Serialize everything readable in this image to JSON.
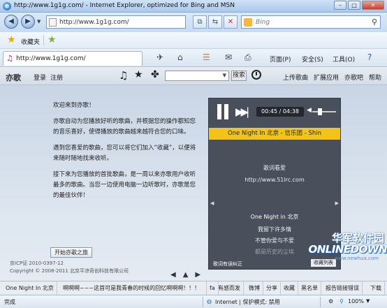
{
  "window": {
    "title": "http://www.1g1g.com/ - Internet Explorer, optimized for Bing and MSN"
  },
  "navbar": {
    "address": "http://www.1g1g.com/",
    "search_placeholder": "Bing"
  },
  "favbar": {
    "favorites_label": "收藏夹"
  },
  "cmdbar": {
    "tab_title": "http://www.1g1g.com/",
    "page_menu": "页面(P)",
    "safety_menu": "安全(S)",
    "tools_menu": "工具(O)"
  },
  "site": {
    "logo": "亦歌",
    "login": "登录",
    "register": "注册",
    "search_button": "搜索",
    "links": [
      "上传歌曲",
      "扩展应用",
      "亦歌吧",
      "帮助"
    ]
  },
  "welcome": {
    "title": "欢迎来到亦歌！",
    "p1": "亦歌自动为您播放好听的歌曲，并根据您的操作都知您的音乐喜好，使得播放的歌曲越来越符合您的口味。",
    "p2": "遇到您喜爱的歌曲，您可以将它们加入“收藏”，以便将来随时随地找来收听。",
    "p3": "接下来为您播放的首批歌曲，是一周以来亦歌用户收听最多的歌曲。当您一边使用电脑一边听歌时，亦歌是您的最佳伙伴！",
    "start_button": "开始亦歌之旅",
    "copyright1": "京ICP证 2010-0397-12",
    "copyright2": "Copyright © 2008-2011 北京平凉奇创科技有限公司"
  },
  "player": {
    "time": "00:45 / 04:38",
    "song": "One Night In 北京 - 信乐团 - Shin",
    "lyric_title": "歌词看爱",
    "lyric_url": "http://www.51lrc.com",
    "lines": [
      "One Night in 北京",
      "我留下许多情",
      "不管你爱与不爱",
      "都是历史的尘埃"
    ],
    "correct_link": "歌词有误纠正",
    "fav_list": "收藏列表"
  },
  "watermark": {
    "cn": "华军软件园",
    "en": "ONLINEDOWN",
    "url": "www.newhua.com"
  },
  "bottombar": {
    "now_playing": "One Night In 北京",
    "marquee": "啊啊啊~~~这首可是我青春的时候的回忆啊啊啊！！！",
    "fa": "fa",
    "items": [
      "有感而发",
      "微博",
      "分享",
      "收藏",
      "黑名单",
      "报告链接错误",
      "下载"
    ]
  },
  "statusbar": {
    "done": "完成",
    "zone": "Internet | 保护模式: 禁用",
    "zoom": "100%"
  }
}
